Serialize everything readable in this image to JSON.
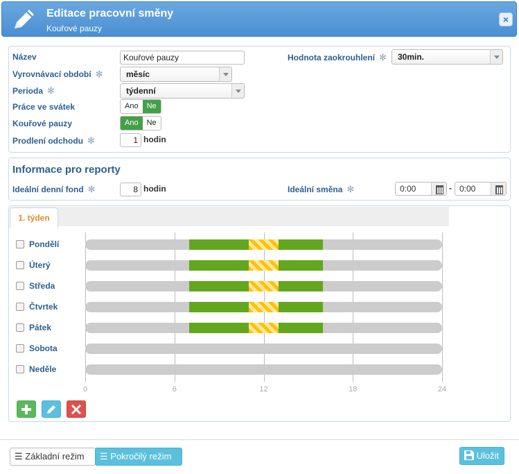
{
  "header": {
    "title": "Editace pracovní směny",
    "subtitle": "Kouřové pauzy",
    "close_label": "×"
  },
  "form": {
    "name": {
      "label": "Název",
      "value": "Kouřové pauzy"
    },
    "rounding": {
      "label": "Hodnota zaokrouhlení",
      "value": "30min."
    },
    "balancing_period": {
      "label": "Vyrovnávací období",
      "value": "měsíc"
    },
    "period": {
      "label": "Perioda",
      "value": "týdenní"
    },
    "holiday_work": {
      "label": "Práce ve svátek",
      "yes": "Ano",
      "no": "Ne",
      "selected": "Ne"
    },
    "smoke_breaks": {
      "label": "Kouřové pauzy",
      "yes": "Ano",
      "no": "Ne",
      "selected": "Ano"
    },
    "leave_extension": {
      "label": "Prodlení odchodu",
      "value": "1",
      "unit": "hodin"
    }
  },
  "reports": {
    "title": "Informace pro reporty",
    "daily_fund": {
      "label": "Ideální denní fond",
      "value": "8",
      "unit": "hodin"
    },
    "ideal_shift": {
      "label": "Ideální směna",
      "from": "0:00",
      "separator": "-",
      "to": "0:00"
    }
  },
  "schedule": {
    "tab_label": "1. týden",
    "axis_ticks": [
      "0",
      "6",
      "12",
      "18",
      "24"
    ],
    "axis_max_hours": 24,
    "days": [
      {
        "name": "Pondělí",
        "checked": false,
        "work": [
          [
            7,
            16
          ]
        ],
        "smoke": [
          [
            11,
            13
          ]
        ]
      },
      {
        "name": "Úterý",
        "checked": false,
        "work": [
          [
            7,
            16
          ]
        ],
        "smoke": [
          [
            11,
            13
          ]
        ]
      },
      {
        "name": "Středa",
        "checked": false,
        "work": [
          [
            7,
            16
          ]
        ],
        "smoke": [
          [
            11,
            13
          ]
        ]
      },
      {
        "name": "Čtvrtek",
        "checked": false,
        "work": [
          [
            7,
            16
          ]
        ],
        "smoke": [
          [
            11,
            13
          ]
        ]
      },
      {
        "name": "Pátek",
        "checked": false,
        "work": [
          [
            7,
            16
          ]
        ],
        "smoke": [
          [
            11,
            13
          ]
        ]
      },
      {
        "name": "Sobota",
        "checked": false,
        "work": [],
        "smoke": []
      },
      {
        "name": "Neděle",
        "checked": false,
        "work": [],
        "smoke": []
      }
    ]
  },
  "footer": {
    "basic_mode": "Základní režim",
    "advanced_mode": "Pokročilý režim",
    "save": "Uložit"
  }
}
